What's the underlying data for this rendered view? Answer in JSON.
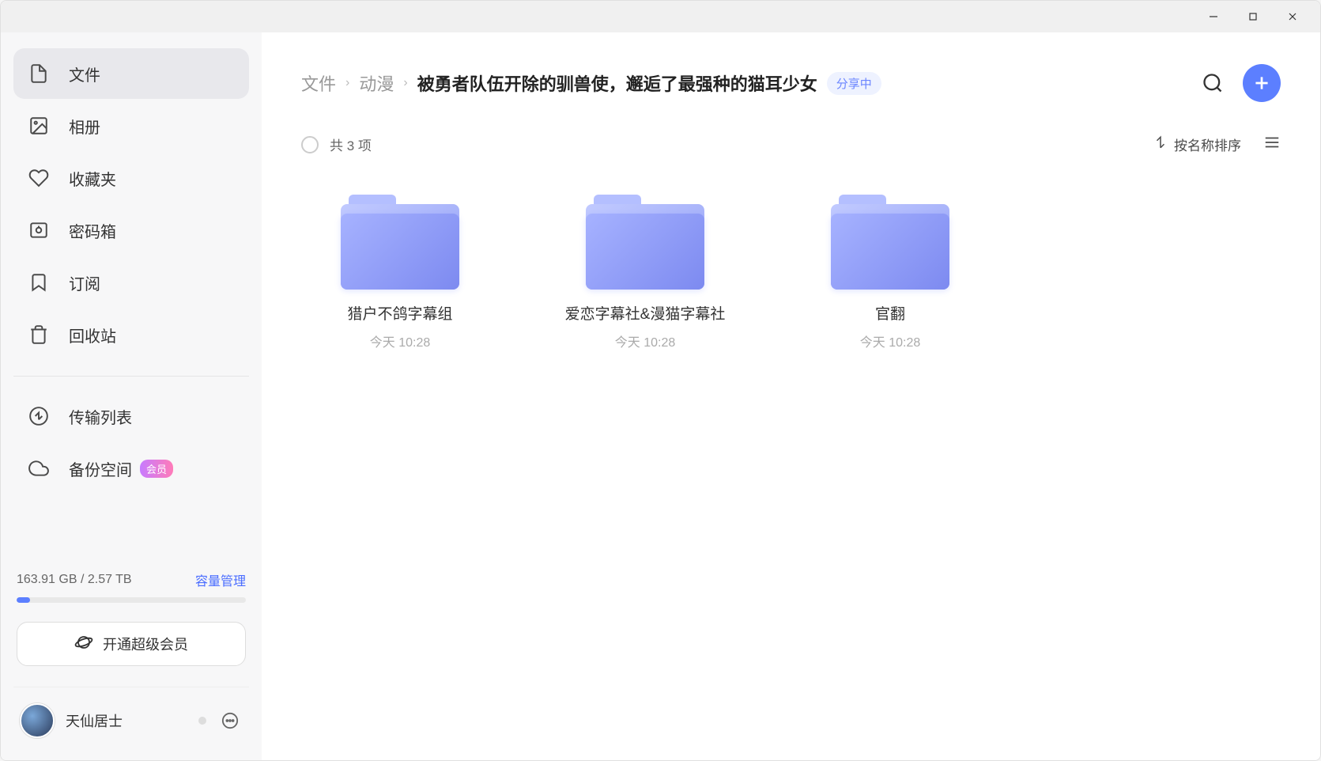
{
  "sidebar": {
    "items": [
      {
        "label": "文件",
        "icon": "file"
      },
      {
        "label": "相册",
        "icon": "photo"
      },
      {
        "label": "收藏夹",
        "icon": "heart"
      },
      {
        "label": "密码箱",
        "icon": "safe"
      },
      {
        "label": "订阅",
        "icon": "bookmark"
      },
      {
        "label": "回收站",
        "icon": "trash"
      }
    ],
    "secondary": [
      {
        "label": "传输列表",
        "icon": "transfer"
      },
      {
        "label": "备份空间",
        "icon": "cloud",
        "badge": "会员"
      }
    ]
  },
  "storage": {
    "used": "163.91 GB",
    "total": "2.57 TB",
    "separator": " / ",
    "manage_label": "容量管理",
    "percent": 6
  },
  "upgrade": {
    "label": "开通超级会员"
  },
  "user": {
    "name": "天仙居士"
  },
  "breadcrumb": {
    "items": [
      "文件",
      "动漫",
      "被勇者队伍开除的驯兽使，邂逅了最强种的猫耳少女"
    ]
  },
  "share_tag": "分享中",
  "item_count": "共 3 项",
  "sort_label": "按名称排序",
  "folders": [
    {
      "name": "猎户不鸽字幕组",
      "date": "今天 10:28"
    },
    {
      "name": "爱恋字幕社&漫猫字幕社",
      "date": "今天 10:28"
    },
    {
      "name": "官翻",
      "date": "今天 10:28"
    }
  ]
}
